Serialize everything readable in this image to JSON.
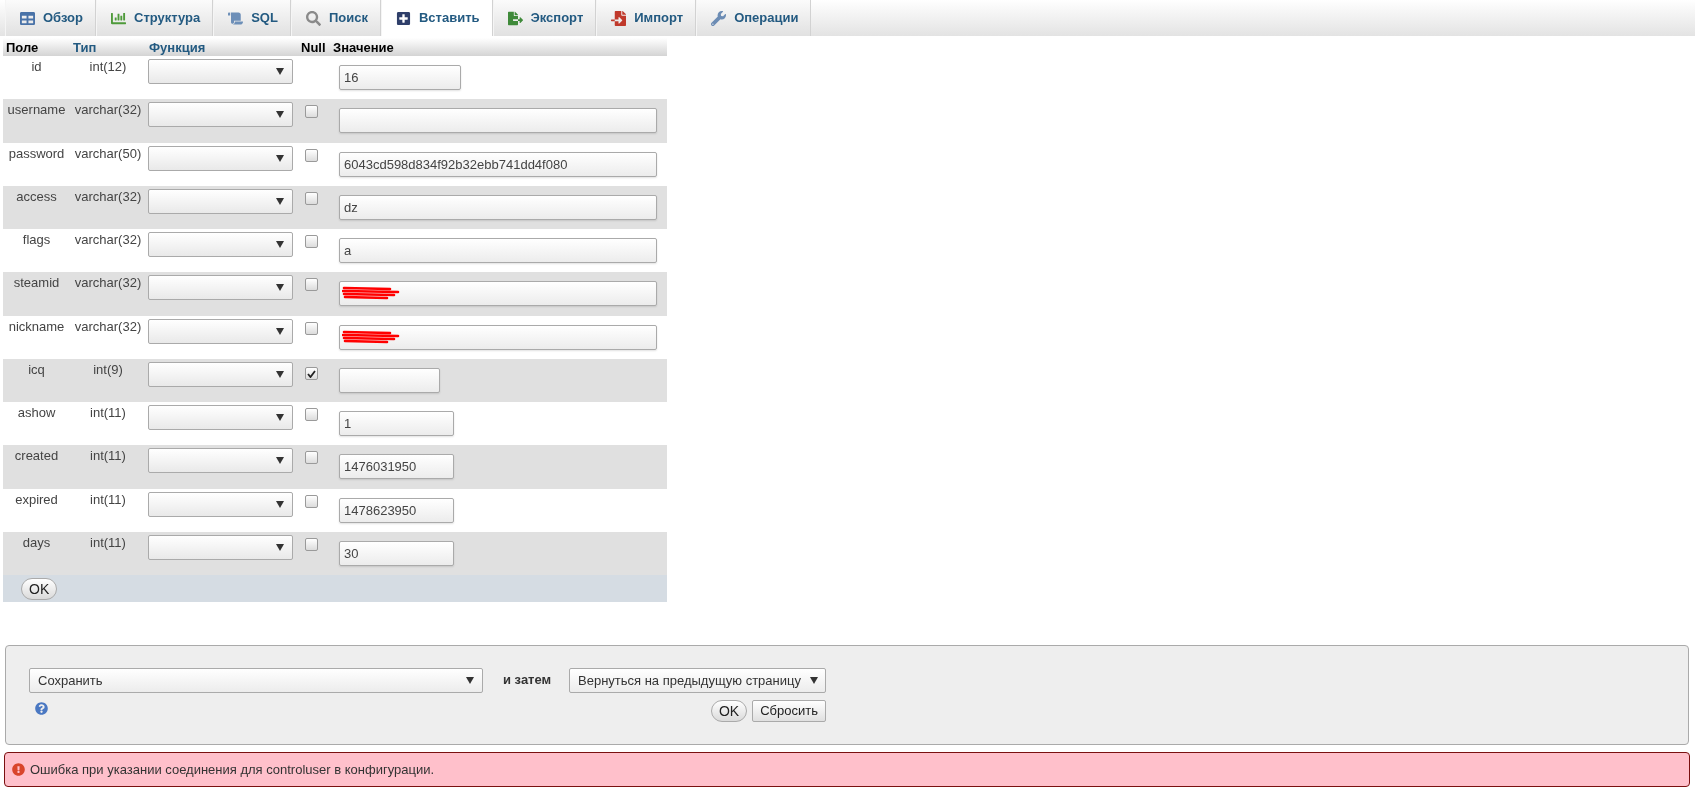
{
  "tabs": [
    {
      "label": "Обзор",
      "selected": false
    },
    {
      "label": "Структура",
      "selected": false
    },
    {
      "label": "SQL",
      "selected": false
    },
    {
      "label": "Поиск",
      "selected": false
    },
    {
      "label": "Вставить",
      "selected": true
    },
    {
      "label": "Экспорт",
      "selected": false
    },
    {
      "label": "Импорт",
      "selected": false
    },
    {
      "label": "Операции",
      "selected": false
    }
  ],
  "table": {
    "columns": [
      {
        "label": "Поле",
        "link": false
      },
      {
        "label": "Тип",
        "link": true
      },
      {
        "label": "Функция",
        "link": true
      },
      {
        "label": "Null",
        "link": false
      },
      {
        "label": "Значение",
        "link": false
      }
    ],
    "rows": [
      {
        "field": "id",
        "type": "int(12)",
        "value": "16",
        "redacted": false
      },
      {
        "field": "username",
        "type": "varchar(32)",
        "null": {
          "checked": false
        },
        "redacted": false
      },
      {
        "field": "password",
        "type": "varchar(50)",
        "null": {
          "checked": false
        },
        "value": "6043cd598d834f92b32ebb741dd4f080",
        "redacted": false
      },
      {
        "field": "access",
        "type": "varchar(32)",
        "null": {
          "checked": false
        },
        "value": "dz",
        "redacted": false
      },
      {
        "field": "flags",
        "type": "varchar(32)",
        "null": {
          "checked": false
        },
        "value": "a",
        "redacted": false
      },
      {
        "field": "steamid",
        "type": "varchar(32)",
        "null": {
          "checked": false
        },
        "redacted": true
      },
      {
        "field": "nickname",
        "type": "varchar(32)",
        "null": {
          "checked": false
        },
        "redacted": true
      },
      {
        "field": "icq",
        "type": "int(9)",
        "null": {
          "checked": true
        },
        "redacted": false
      },
      {
        "field": "ashow",
        "type": "int(11)",
        "null": {
          "checked": false
        },
        "value": "1",
        "redacted": false
      },
      {
        "field": "created",
        "type": "int(11)",
        "null": {
          "checked": false
        },
        "value": "1476031950",
        "redacted": false
      },
      {
        "field": "expired",
        "type": "int(11)",
        "null": {
          "checked": false
        },
        "value": "1478623950",
        "redacted": false
      },
      {
        "field": "days",
        "type": "int(11)",
        "null": {
          "checked": false
        },
        "value": "30",
        "redacted": false
      }
    ],
    "footer_button": "OK"
  },
  "actions": {
    "action_select": "Сохранить",
    "then_label": "и затем",
    "after_select": "Вернуться на предыдущую страницу",
    "buttons": [
      {
        "label": "OK",
        "kind": "submit"
      },
      {
        "label": "Сбросить",
        "kind": "reset"
      }
    ]
  },
  "error": {
    "message": "Ошибка при указании соединения для controluser в конфигурации."
  }
}
